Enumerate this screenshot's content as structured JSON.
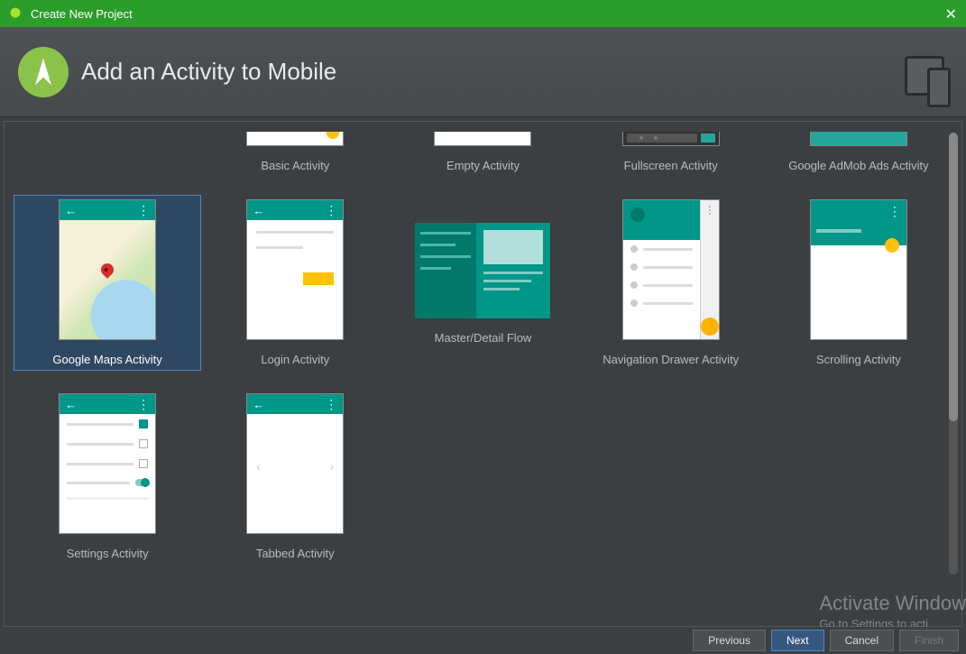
{
  "window": {
    "title": "Create New Project",
    "close_glyph": "✕"
  },
  "header": {
    "title": "Add an Activity to Mobile"
  },
  "activities": {
    "row1": [
      {
        "label": "Basic Activity"
      },
      {
        "label": "Empty Activity"
      },
      {
        "label": "Fullscreen Activity"
      },
      {
        "label": "Google AdMob Ads Activity"
      }
    ],
    "row2": [
      {
        "label": "Google Maps Activity",
        "selected": true
      },
      {
        "label": "Login Activity"
      },
      {
        "label": "Master/Detail Flow"
      },
      {
        "label": "Navigation Drawer Activity"
      },
      {
        "label": "Scrolling Activity"
      }
    ],
    "row3": [
      {
        "label": "Settings Activity"
      },
      {
        "label": "Tabbed Activity"
      }
    ]
  },
  "buttons": {
    "previous": "Previous",
    "next": "Next",
    "cancel": "Cancel",
    "finish": "Finish"
  },
  "watermark": {
    "title": "Activate Window",
    "subtitle": "Go to Settings to acti"
  },
  "glyphs": {
    "back": "←",
    "vdots": "⋮",
    "chev_left": "‹",
    "chev_right": "›"
  }
}
